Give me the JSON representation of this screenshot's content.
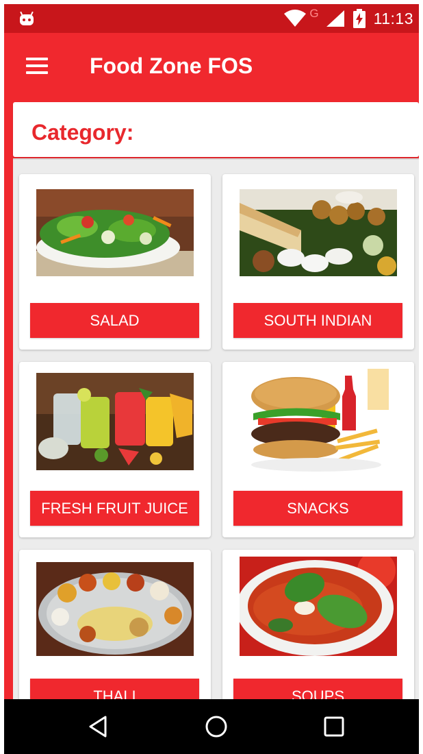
{
  "status_bar": {
    "time": "11:13",
    "network_letter": "G",
    "icons": [
      "android-debug-icon",
      "wifi-icon",
      "cell-signal-icon",
      "battery-charging-icon"
    ]
  },
  "app_bar": {
    "title": "Food Zone FOS",
    "menu_icon": "hamburger-menu-icon"
  },
  "section": {
    "label": "Category:"
  },
  "categories": [
    {
      "label": "SALAD",
      "image": "salad-image"
    },
    {
      "label": "SOUTH INDIAN",
      "image": "south-indian-image"
    },
    {
      "label": "FRESH FRUIT JUICE",
      "image": "fruit-juice-image"
    },
    {
      "label": "SNACKS",
      "image": "burger-snacks-image"
    },
    {
      "label": "THALI",
      "image": "thali-image"
    },
    {
      "label": "SOUPS",
      "image": "soup-image"
    }
  ],
  "nav_bar": {
    "icons": [
      "back-icon",
      "home-icon",
      "recents-icon"
    ]
  },
  "colors": {
    "status_bar": "#c8161b",
    "primary": "#f0282e",
    "accent_text": "#e8282d",
    "grid_background": "#ececec"
  }
}
